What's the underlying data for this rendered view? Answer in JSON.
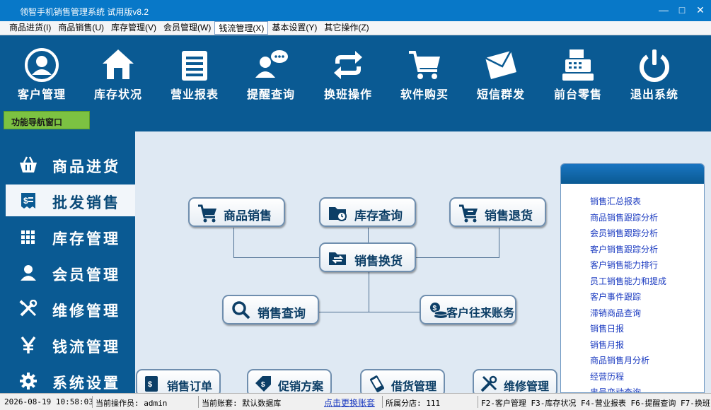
{
  "window": {
    "title": "领智手机销售管理系统 试用版v8.2"
  },
  "menu": [
    "商品进货(I)",
    "商品销售(U)",
    "库存管理(V)",
    "会员管理(W)",
    "钱流管理(X)",
    "基本设置(Y)",
    "其它操作(Z)"
  ],
  "toolbar": [
    {
      "label": "客户管理",
      "icon": "customer-icon"
    },
    {
      "label": "库存状况",
      "icon": "home-icon"
    },
    {
      "label": "营业报表",
      "icon": "report-icon"
    },
    {
      "label": "提醒查询",
      "icon": "reminder-icon"
    },
    {
      "label": "换班操作",
      "icon": "shift-icon"
    },
    {
      "label": "软件购买",
      "icon": "cart-icon"
    },
    {
      "label": "短信群发",
      "icon": "mail-icon"
    },
    {
      "label": "前台零售",
      "icon": "register-icon"
    },
    {
      "label": "退出系统",
      "icon": "power-icon"
    }
  ],
  "nav_tab": "功能导航窗口",
  "sidebar": [
    {
      "label": "商品进货",
      "icon": "basket-icon"
    },
    {
      "label": "批发销售",
      "icon": "invoice-icon"
    },
    {
      "label": "库存管理",
      "icon": "grid-icon"
    },
    {
      "label": "会员管理",
      "icon": "user-icon"
    },
    {
      "label": "维修管理",
      "icon": "tools-icon"
    },
    {
      "label": "钱流管理",
      "icon": "yen-icon"
    },
    {
      "label": "系统设置",
      "icon": "gear-icon"
    }
  ],
  "flow": {
    "sales": "商品销售",
    "stock_query": "库存查询",
    "sales_return": "销售退货",
    "exchange": "销售换货",
    "sales_query": "销售查询",
    "customer_accounts": "客户往来账务"
  },
  "bottom_buttons": [
    "销售订单",
    "促销方案",
    "借货管理",
    "维修管理"
  ],
  "right_links": [
    "销售汇总报表",
    "商品销售跟踪分析",
    "会员销售跟踪分析",
    "客户销售跟踪分析",
    "客户销售能力排行",
    "员工销售能力和提成",
    "客户事件跟踪",
    "滞销商品查询",
    "销售日报",
    "销售月报",
    "商品销售月分析",
    "经营历程",
    "串号变动查询"
  ],
  "status": {
    "datetime": "2026-08-19 10:58:03",
    "operator": "当前操作员: admin",
    "account": "当前账套: 默认数据库",
    "switch_link": "点击更换账套",
    "branch": "所属分店: 111",
    "hotkeys": "F2-客户管理 F3-库存状况 F4-营业报表 F6-提醒查询 F7-换班"
  },
  "colors": {
    "background": "#0a5a93",
    "titlebar": "#0878c8",
    "main_panel": "#dfe9f3",
    "nav_tab": "#7cc242",
    "link": "#1a3ac0"
  }
}
